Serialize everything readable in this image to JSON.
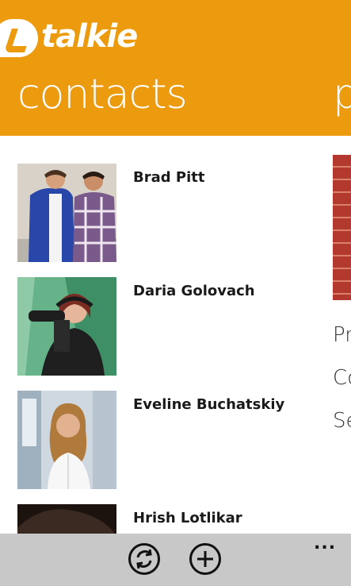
{
  "app": {
    "logo_text": "talkie"
  },
  "pivot": {
    "title": "contacts",
    "next_title_peek": "p"
  },
  "contacts": [
    {
      "name": "Brad Pitt",
      "photo": "photo-two-young-men"
    },
    {
      "name": "Daria Golovach",
      "photo": "photo-woman-with-camera"
    },
    {
      "name": "Eveline Buchatskiy",
      "photo": "photo-smiling-woman"
    },
    {
      "name": "Hrish Lotlikar",
      "photo": "photo-person-partial"
    }
  ],
  "next_panel_peek": {
    "lines": [
      "Pr",
      "Co",
      "Se"
    ]
  },
  "appbar": {
    "sync_icon": "sync-icon",
    "add_icon": "add-icon",
    "more_label": "..."
  },
  "colors": {
    "accent": "#ec9a0e",
    "appbar": "#c8c8c8"
  }
}
